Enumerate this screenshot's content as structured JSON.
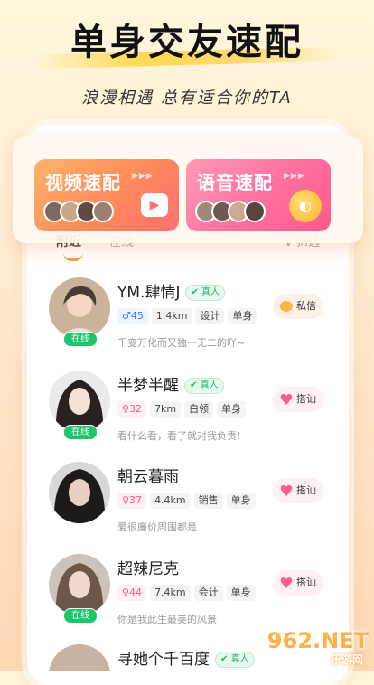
{
  "header": {
    "title": "单身交友速配",
    "subtitle": "浪漫相遇  总有适合你的TA"
  },
  "matching": {
    "video_label": "视频速配",
    "voice_label": "语音速配"
  },
  "tabs": {
    "nearby": "附近",
    "online": "在线",
    "filter": "筛选"
  },
  "users": [
    {
      "name": "YM.肆情J",
      "verified": "真人",
      "gender_age": "♂45",
      "distance": "1.4km",
      "job": "设计",
      "status": "单身",
      "bio": "千变万化而又独一无二的吖~",
      "online": "在线",
      "action": "私信",
      "avatar_color": "#c9b39a"
    },
    {
      "name": "半梦半醒",
      "verified": "真人",
      "gender_age": "♀32",
      "distance": "7km",
      "job": "白领",
      "status": "单身",
      "bio": "看什么看，看了就对我负责!",
      "online": "在线",
      "action": "搭讪",
      "avatar_color": "#6b5b58"
    },
    {
      "name": "朝云暮雨",
      "verified": "",
      "gender_age": "♀37",
      "distance": "4.4km",
      "job": "销售",
      "status": "单身",
      "bio": "爱很廉价周围都是",
      "online": "",
      "action": "搭讪",
      "avatar_color": "#3a3a3a"
    },
    {
      "name": "超辣尼克",
      "verified": "",
      "gender_age": "♀44",
      "distance": "7.4km",
      "job": "会计",
      "status": "单身",
      "bio": "你是我此生最美的风景",
      "online": "在线",
      "action": "搭讪",
      "avatar_color": "#9a8676"
    },
    {
      "name": "寻她个千百度",
      "verified": "真人",
      "gender_age": "",
      "distance": "",
      "job": "",
      "status": "",
      "bio": "",
      "online": "",
      "action": "",
      "avatar_color": "#b9a08a"
    }
  ],
  "watermark": {
    "main": "962.NET",
    "sub": "乐游网"
  },
  "colors": {
    "accent_orange": "#ff9a3c",
    "online_green": "#1fc46b",
    "video_gradient_start": "#ffb36a",
    "voice_gradient_start": "#ff9ab4"
  }
}
